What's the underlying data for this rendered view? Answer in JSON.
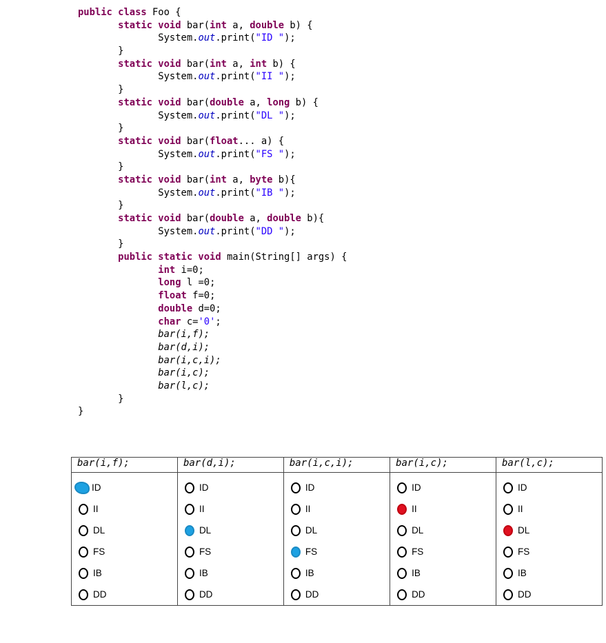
{
  "code_lines": [
    [
      {
        "t": "public class ",
        "c": "kw"
      },
      {
        "t": "Foo {",
        "c": ""
      }
    ],
    [
      {
        "t": "       static void ",
        "c": "kw"
      },
      {
        "t": "bar(",
        "c": ""
      },
      {
        "t": "int",
        "c": "kw"
      },
      {
        "t": " a, ",
        "c": ""
      },
      {
        "t": "double",
        "c": "kw"
      },
      {
        "t": " b) {",
        "c": ""
      }
    ],
    [
      {
        "t": "              System.",
        "c": ""
      },
      {
        "t": "out",
        "c": "fld"
      },
      {
        "t": ".print(",
        "c": ""
      },
      {
        "t": "\"ID \"",
        "c": "str"
      },
      {
        "t": ");",
        "c": ""
      }
    ],
    [
      {
        "t": "       }",
        "c": ""
      }
    ],
    [
      {
        "t": "       static void ",
        "c": "kw"
      },
      {
        "t": "bar(",
        "c": ""
      },
      {
        "t": "int",
        "c": "kw"
      },
      {
        "t": " a, ",
        "c": ""
      },
      {
        "t": "int",
        "c": "kw"
      },
      {
        "t": " b) {",
        "c": ""
      }
    ],
    [
      {
        "t": "              System.",
        "c": ""
      },
      {
        "t": "out",
        "c": "fld"
      },
      {
        "t": ".print(",
        "c": ""
      },
      {
        "t": "\"II \"",
        "c": "str"
      },
      {
        "t": ");",
        "c": ""
      }
    ],
    [
      {
        "t": "       }",
        "c": ""
      }
    ],
    [
      {
        "t": "       static void ",
        "c": "kw"
      },
      {
        "t": "bar(",
        "c": ""
      },
      {
        "t": "double",
        "c": "kw"
      },
      {
        "t": " a, ",
        "c": ""
      },
      {
        "t": "long",
        "c": "kw"
      },
      {
        "t": " b) {",
        "c": ""
      }
    ],
    [
      {
        "t": "              System.",
        "c": ""
      },
      {
        "t": "out",
        "c": "fld"
      },
      {
        "t": ".print(",
        "c": ""
      },
      {
        "t": "\"DL \"",
        "c": "str"
      },
      {
        "t": ");",
        "c": ""
      }
    ],
    [
      {
        "t": "       }",
        "c": ""
      }
    ],
    [
      {
        "t": "       static void ",
        "c": "kw"
      },
      {
        "t": "bar(",
        "c": ""
      },
      {
        "t": "float",
        "c": "kw"
      },
      {
        "t": "... a) {",
        "c": ""
      }
    ],
    [
      {
        "t": "              System.",
        "c": ""
      },
      {
        "t": "out",
        "c": "fld"
      },
      {
        "t": ".print(",
        "c": ""
      },
      {
        "t": "\"FS \"",
        "c": "str"
      },
      {
        "t": ");",
        "c": ""
      }
    ],
    [
      {
        "t": "       }",
        "c": ""
      }
    ],
    [
      {
        "t": "       static void ",
        "c": "kw"
      },
      {
        "t": "bar(",
        "c": ""
      },
      {
        "t": "int",
        "c": "kw"
      },
      {
        "t": " a, ",
        "c": ""
      },
      {
        "t": "byte",
        "c": "kw"
      },
      {
        "t": " b){",
        "c": ""
      }
    ],
    [
      {
        "t": "              System.",
        "c": ""
      },
      {
        "t": "out",
        "c": "fld"
      },
      {
        "t": ".print(",
        "c": ""
      },
      {
        "t": "\"IB \"",
        "c": "str"
      },
      {
        "t": ");",
        "c": ""
      }
    ],
    [
      {
        "t": "       }",
        "c": ""
      }
    ],
    [
      {
        "t": "       static void ",
        "c": "kw"
      },
      {
        "t": "bar(",
        "c": ""
      },
      {
        "t": "double",
        "c": "kw"
      },
      {
        "t": " a, ",
        "c": ""
      },
      {
        "t": "double",
        "c": "kw"
      },
      {
        "t": " b){",
        "c": ""
      }
    ],
    [
      {
        "t": "              System.",
        "c": ""
      },
      {
        "t": "out",
        "c": "fld"
      },
      {
        "t": ".print(",
        "c": ""
      },
      {
        "t": "\"DD \"",
        "c": "str"
      },
      {
        "t": ");",
        "c": ""
      }
    ],
    [
      {
        "t": "       }",
        "c": ""
      }
    ],
    [
      {
        "t": "       public static void ",
        "c": "kw"
      },
      {
        "t": "main(String[] args) {",
        "c": ""
      }
    ],
    [
      {
        "t": "              ",
        "c": ""
      },
      {
        "t": "int",
        "c": "kw"
      },
      {
        "t": " i=0;",
        "c": ""
      }
    ],
    [
      {
        "t": "              ",
        "c": ""
      },
      {
        "t": "long",
        "c": "kw"
      },
      {
        "t": " l =0;",
        "c": ""
      }
    ],
    [
      {
        "t": "              ",
        "c": ""
      },
      {
        "t": "float",
        "c": "kw"
      },
      {
        "t": " f=0;",
        "c": ""
      }
    ],
    [
      {
        "t": "              ",
        "c": ""
      },
      {
        "t": "double",
        "c": "kw"
      },
      {
        "t": " d=0;",
        "c": ""
      }
    ],
    [
      {
        "t": "              ",
        "c": ""
      },
      {
        "t": "char",
        "c": "kw"
      },
      {
        "t": " c=",
        "c": ""
      },
      {
        "t": "'0'",
        "c": "str"
      },
      {
        "t": ";",
        "c": ""
      }
    ],
    [
      {
        "t": "              ",
        "c": ""
      },
      {
        "t": "bar(i,f);",
        "c": "call"
      }
    ],
    [
      {
        "t": "              ",
        "c": ""
      },
      {
        "t": "bar(d,i);",
        "c": "call"
      }
    ],
    [
      {
        "t": "              ",
        "c": ""
      },
      {
        "t": "bar(i,c,i);",
        "c": "call"
      }
    ],
    [
      {
        "t": "              ",
        "c": ""
      },
      {
        "t": "bar(i,c);",
        "c": "call"
      }
    ],
    [
      {
        "t": "              ",
        "c": ""
      },
      {
        "t": "bar(l,c);",
        "c": "call"
      }
    ],
    [
      {
        "t": "       }",
        "c": ""
      }
    ],
    [
      {
        "t": "}",
        "c": ""
      }
    ]
  ],
  "table": {
    "headers": [
      "bar(i,f);",
      "bar(d,i);",
      "bar(i,c,i);",
      "bar(i,c);",
      "bar(l,c);"
    ],
    "options": [
      "ID",
      "II",
      "DL",
      "FS",
      "IB",
      "DD"
    ],
    "marks": [
      {
        "option": "ID",
        "color": "blue",
        "style": "scribble"
      },
      {
        "option": "DL",
        "color": "blue",
        "style": "fill"
      },
      {
        "option": "FS",
        "color": "blue",
        "style": "fill"
      },
      {
        "option": "II",
        "color": "red",
        "style": "fill"
      },
      {
        "option": "DL",
        "color": "red",
        "style": "fill"
      }
    ]
  },
  "colors": {
    "keyword": "#7f0055",
    "string": "#2a00ff",
    "field": "#0000c0",
    "mark_blue": "#1da1e2",
    "mark_red": "#e01020"
  }
}
